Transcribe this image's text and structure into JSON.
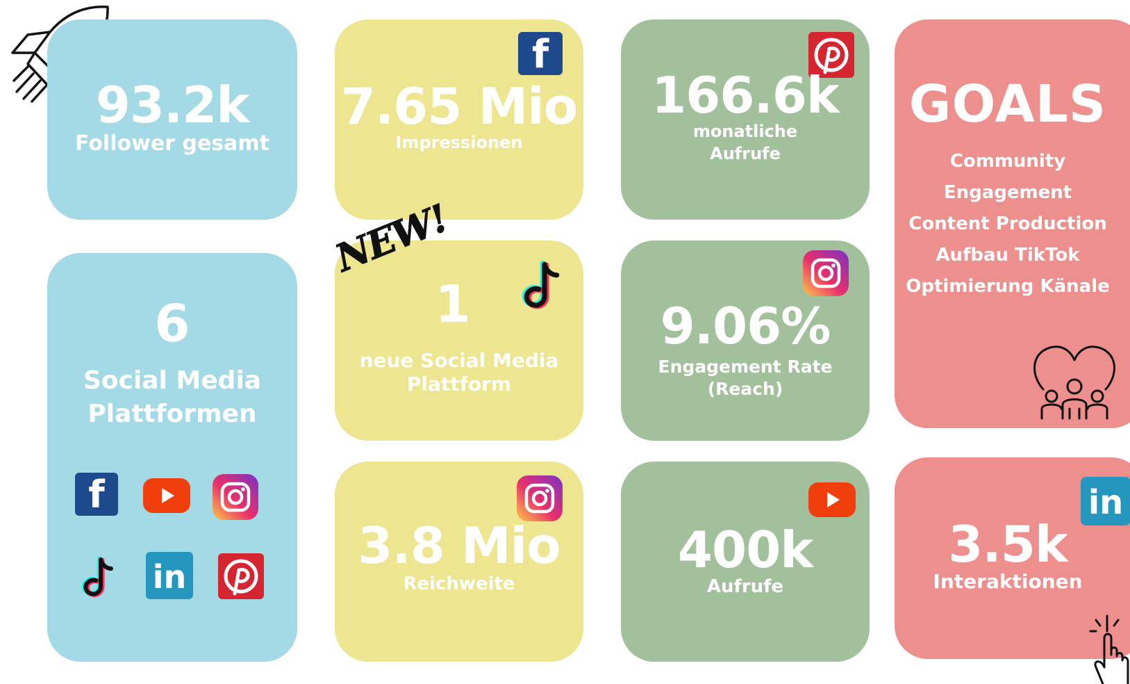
{
  "cards": {
    "followers": {
      "value": "93.2k",
      "label": "Follower gesamt"
    },
    "impressions": {
      "value": "7.65 Mio",
      "label": "Impressionen"
    },
    "pinterest": {
      "value": "166.6k",
      "label_line1": "monatliche",
      "label_line2": "Aufrufe"
    },
    "goals": {
      "title": "GOALS",
      "items": [
        "Community",
        "Engagement",
        "Content Production",
        "Aufbau TikTok",
        "Optimierung Känale"
      ]
    },
    "platforms": {
      "value": "6",
      "label_line1": "Social Media",
      "label_line2": "Plattformen"
    },
    "new_platform": {
      "badge": "NEW!",
      "value": "1",
      "label_line1": "neue Social Media",
      "label_line2": "Plattform"
    },
    "engagement": {
      "value": "9.06%",
      "label_line1": "Engagement Rate",
      "label_line2": "(Reach)"
    },
    "reach": {
      "value": "3.8 Mio",
      "label": "Reichweite"
    },
    "youtube": {
      "value": "400k",
      "label": "Aufrufe"
    },
    "linkedin": {
      "value": "3.5k",
      "label": "Interaktionen"
    }
  },
  "icons": {
    "facebook": "f",
    "linkedin": "in"
  },
  "colors": {
    "blue": "#a3dae5",
    "yellow": "#ede58f",
    "green": "#a1c09b",
    "pink": "#ed8f8c",
    "facebook": "#1e4a8d",
    "pinterest": "#d42530",
    "youtube": "#f03e0c",
    "linkedin": "#2596be"
  }
}
